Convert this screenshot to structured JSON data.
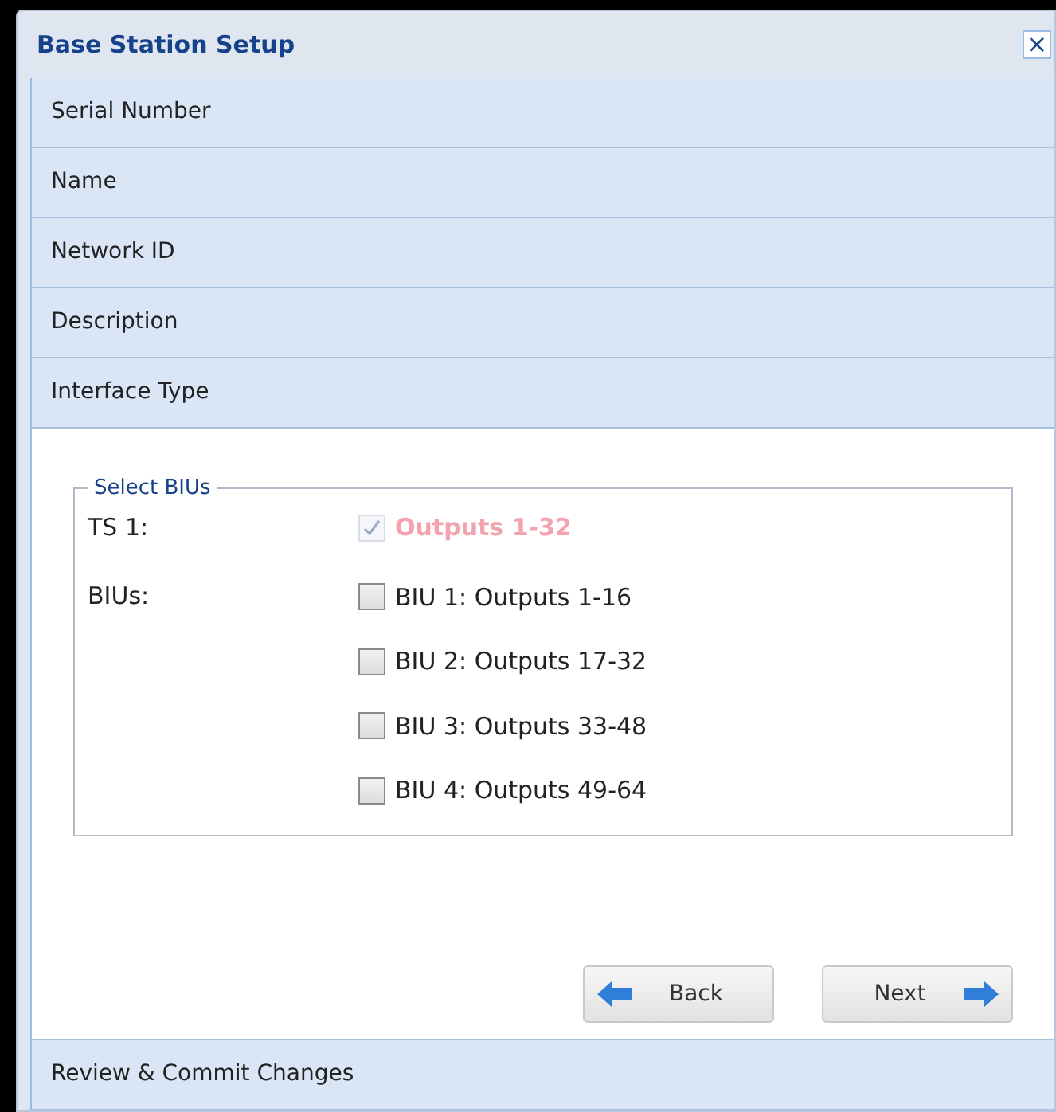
{
  "dialog": {
    "title": "Base Station Setup",
    "close": "×"
  },
  "sections": [
    {
      "label": "Serial Number"
    },
    {
      "label": "Name"
    },
    {
      "label": "Network ID"
    },
    {
      "label": "Description"
    },
    {
      "label": "Interface Type"
    }
  ],
  "last_section": {
    "label": "Review & Commit Changes"
  },
  "panel": {
    "legend": "Select BIUs",
    "ts": {
      "label": "TS 1:",
      "option": {
        "label": "Outputs 1-32",
        "checked": true,
        "disabled": true
      }
    },
    "bius": {
      "label": "BIUs:",
      "options": [
        {
          "label": "BIU 1: Outputs 1-16",
          "checked": false,
          "disabled": false
        },
        {
          "label": "BIU 2: Outputs 17-32",
          "checked": false,
          "disabled": false
        },
        {
          "label": "BIU 3: Outputs 33-48",
          "checked": false,
          "disabled": false
        },
        {
          "label": "BIU 4: Outputs 49-64",
          "checked": false,
          "disabled": false
        }
      ]
    },
    "buttons": [
      {
        "label": "Back",
        "kind": "back"
      },
      {
        "label": "Next",
        "kind": "next"
      }
    ]
  }
}
